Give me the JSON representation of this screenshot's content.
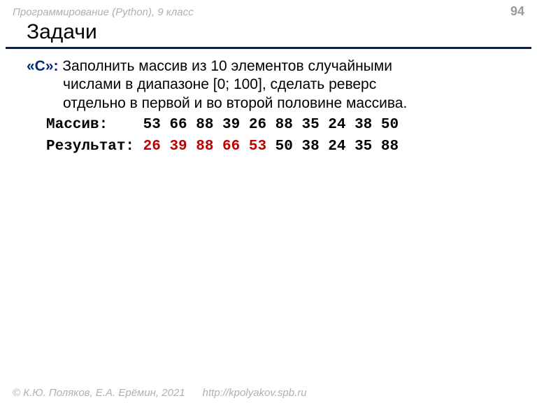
{
  "header": {
    "course": "Программирование (Python), 9 класс",
    "page": "94"
  },
  "title": "Задачи",
  "task": {
    "label": "«C»:",
    "text_line1": " Заполнить массив из 10 элементов случайными",
    "text_line2": "числами в диапазоне [0; 100], сделать реверс",
    "text_line3": "отдельно в первой и во второй половине массива."
  },
  "example": {
    "input_label": "Массив:   ",
    "input_values": " 53 66 88 39 26 88 35 24 38 50",
    "result_label": "Результат:",
    "result_first_half": " 26 39 88 66 53",
    "result_second_half": " 50 38 24 35 88"
  },
  "footer": {
    "copyright": "© К.Ю. Поляков, Е.А. Ерёмин, 2021",
    "url": "http://kpolyakov.spb.ru"
  }
}
